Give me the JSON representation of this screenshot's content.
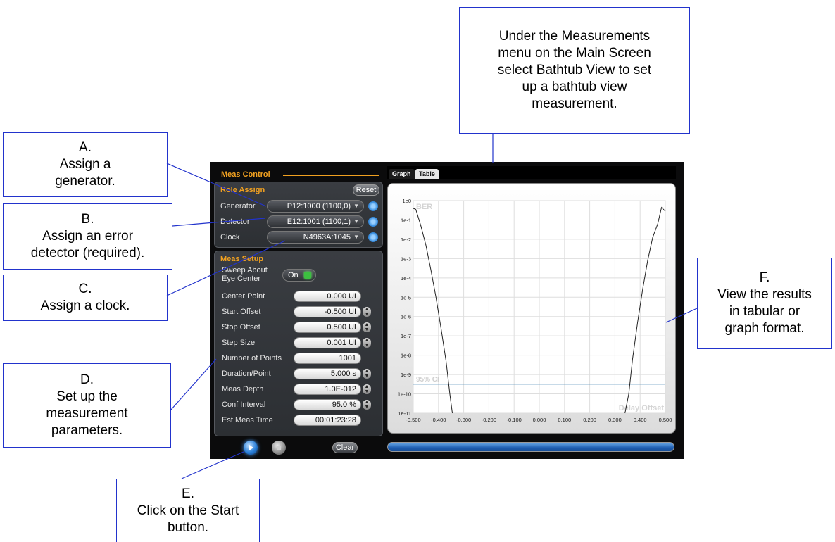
{
  "callouts": {
    "top": [
      "Under the Measurements",
      "menu on the Main Screen",
      "select Bathtub View to set",
      "up a bathtub view",
      "measurement."
    ],
    "a": [
      "A.",
      "Assign a",
      "generator."
    ],
    "b": [
      "B.",
      "Assign an error",
      "detector (required)."
    ],
    "c": [
      "C.",
      "Assign a clock."
    ],
    "d": [
      "D.",
      "Set up the",
      "measurement",
      "parameters."
    ],
    "e": [
      "E.",
      "Click on the Start",
      "button."
    ],
    "f": [
      "F.",
      "View the results",
      "in tabular or",
      "graph format."
    ]
  },
  "meas_control": {
    "title": "Meas Control",
    "assign": {
      "title": "Role Assign",
      "reset": "Reset",
      "generator_label": "Generator",
      "generator_value": "P12:1000 (1100,0)",
      "detector_label": "Detector",
      "detector_value": "E12:1001 (1100,1)",
      "clock_label": "Clock",
      "clock_value": "N4963A:1045"
    },
    "setup": {
      "title": "Meas Setup",
      "sweep_label_1": "Sweep About",
      "sweep_label_2": "Eye Center",
      "sweep_toggle": "On",
      "params": [
        {
          "label": "Center Point",
          "value": "0.000 UI"
        },
        {
          "label": "Start Offset",
          "value": "-0.500 UI"
        },
        {
          "label": "Stop Offset",
          "value": "0.500 UI"
        },
        {
          "label": "Step Size",
          "value": "0.001 UI"
        },
        {
          "label": "Number of Points",
          "value": "1001"
        },
        {
          "label": "Duration/Point",
          "value": "5.000 s"
        },
        {
          "label": "Meas Depth",
          "value": "1.0E-012"
        },
        {
          "label": "Conf Interval",
          "value": "95.0 %"
        },
        {
          "label": "Est Meas Time",
          "value": "00:01:23:28"
        }
      ]
    },
    "clear": "Clear"
  },
  "tabs": [
    "Graph",
    "Table"
  ],
  "colors": {
    "accent": "#f0a020",
    "callout_border": "#2233cc",
    "ci_line": "#6a9ec0"
  },
  "chart_data": {
    "type": "line",
    "x_ticks": [
      "-0.500",
      "-0.400",
      "-0.300",
      "-0.200",
      "-0.100",
      "0.000",
      "0.100",
      "0.200",
      "0.300",
      "0.400",
      "0.500"
    ],
    "y_ticks": [
      "1e0",
      "1e-1",
      "1e-2",
      "1e-3",
      "1e-4",
      "1e-5",
      "1e-6",
      "1e-7",
      "1e-8",
      "1e-9",
      "1e-10",
      "1e-11"
    ],
    "xlim": [
      -0.5,
      0.5
    ],
    "ylim_log10": [
      -11,
      0
    ],
    "ylabel": "BER",
    "xlabel": "Delay Offset",
    "ci_label": "95% CI",
    "ci_log10": -9.5,
    "grid": true,
    "series": [
      {
        "x": [
          -0.5,
          -0.49,
          -0.47,
          -0.45,
          -0.43,
          -0.41,
          -0.39,
          -0.37,
          -0.355,
          -0.345
        ],
        "y_log10": [
          -0.4,
          -0.45,
          -1.3,
          -2.3,
          -3.6,
          -5.0,
          -6.6,
          -8.3,
          -10.0,
          -11.0
        ]
      },
      {
        "x": [
          0.34,
          0.355,
          0.37,
          0.39,
          0.41,
          0.43,
          0.45,
          0.47,
          0.485,
          0.5
        ],
        "y_log10": [
          -11.0,
          -10.0,
          -8.2,
          -6.3,
          -4.6,
          -3.1,
          -1.9,
          -1.2,
          -0.35,
          -0.55
        ]
      }
    ]
  }
}
